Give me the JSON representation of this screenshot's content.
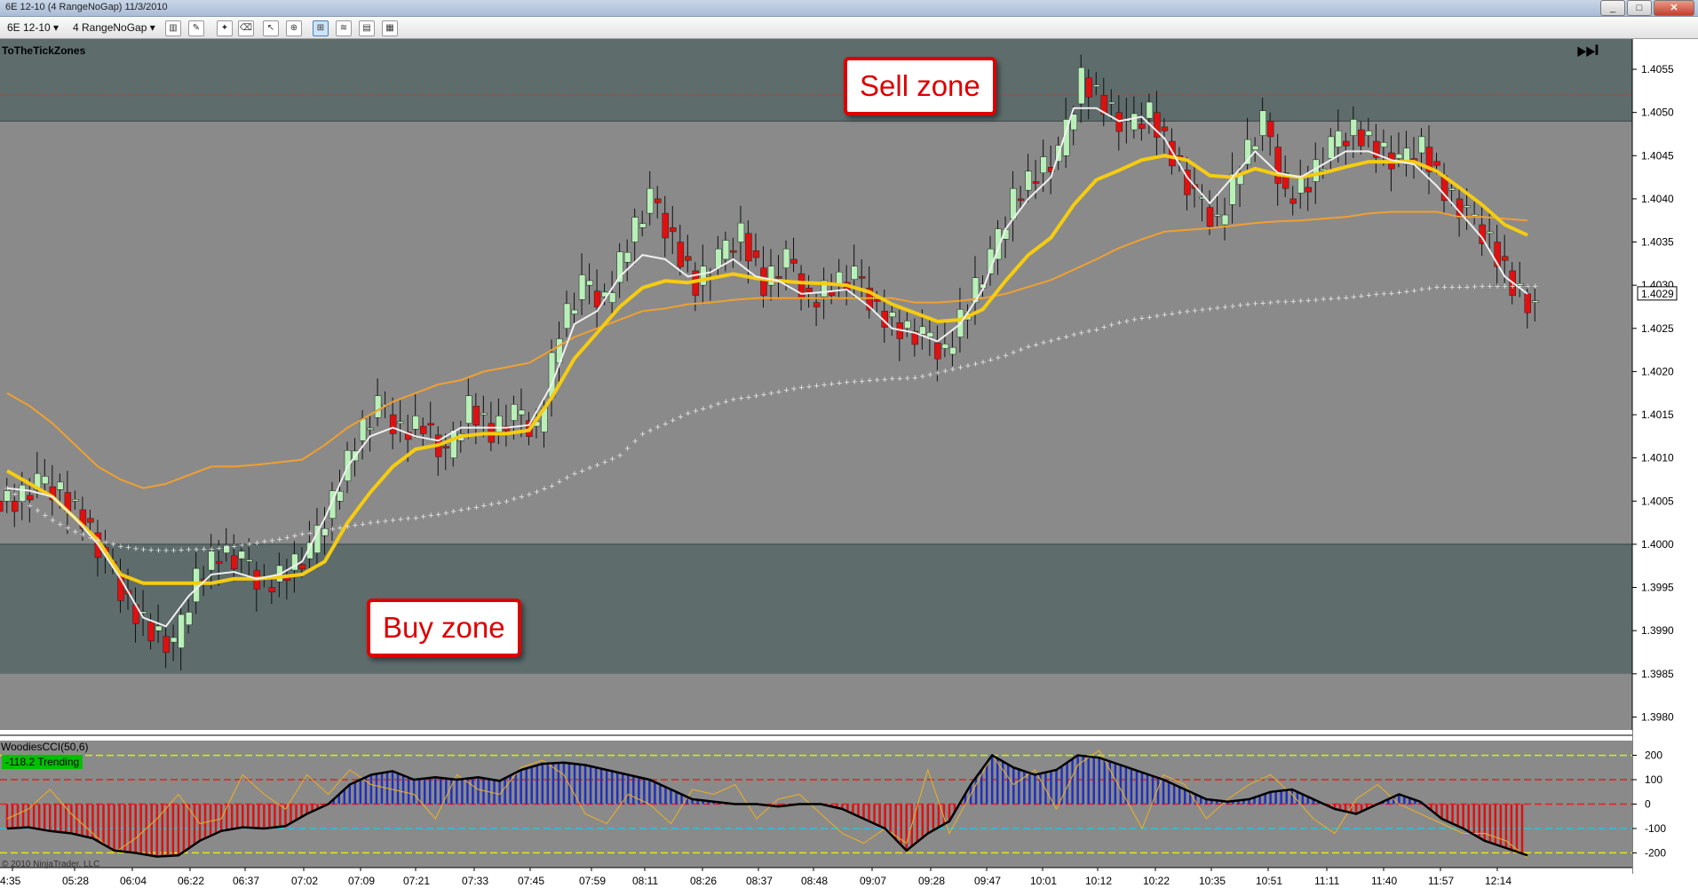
{
  "window": {
    "title": "6E 12-10 (4 RangeNoGap)  11/3/2010"
  },
  "toolbar": {
    "instrument": "6E 12-10",
    "period": "4 RangeNoGap"
  },
  "study": {
    "name": "ToTheTickZones"
  },
  "callouts": {
    "sell": "Sell zone",
    "buy": "Buy zone"
  },
  "cci": {
    "label": "WoodiesCCI(50,6)",
    "status": "-118.2 Trending",
    "status_color": "#00c000"
  },
  "footer": {
    "copyright": "© 2010 NinjaTrader, LLC"
  },
  "colors": {
    "bg_mid": "#8a8a8a",
    "bg_zone": "#5e6c6c",
    "up": "#b8f0b8",
    "down": "#e01010",
    "ema_fast": "#f0f0f0",
    "ema_mid": "#f5cc10",
    "ema_slow": "#f0a030",
    "dots": "#e8e8e8"
  },
  "chart_data": [
    {
      "type": "candlestick",
      "title": "ToTheTickZones",
      "y_ticks": [
        "1.4055",
        "1.4050",
        "1.4045",
        "1.4040",
        "1.4035",
        "1.4030",
        "1.4025",
        "1.4020",
        "1.4015",
        "1.4010",
        "1.4005",
        "1.4000",
        "1.3995",
        "1.3990",
        "1.3985",
        "1.3980"
      ],
      "ylim": [
        1.39785,
        1.40585
      ],
      "last_price": "1.4029",
      "x_ticks": [
        "4:35",
        "05:28",
        "06:04",
        "06:22",
        "06:37",
        "07:02",
        "07:09",
        "07:21",
        "07:33",
        "07:45",
        "07:59",
        "08:11",
        "08:26",
        "08:37",
        "08:48",
        "09:07",
        "09:28",
        "09:47",
        "10:01",
        "10:12",
        "10:22",
        "10:35",
        "10:51",
        "11:11",
        "11:40",
        "11:57",
        "12:14"
      ],
      "sell_zone": {
        "low": 1.4049,
        "high": 1.4058,
        "line": 1.4052
      },
      "buy_zone": {
        "low": 1.3985,
        "high": 1.4
      },
      "close_path": [
        1.4005,
        1.4007,
        1.4006,
        1.4003,
        1.3998,
        1.3993,
        1.399,
        1.3988,
        1.3996,
        1.3999,
        1.3998,
        1.3995,
        1.3997,
        1.3999,
        1.4005,
        1.4012,
        1.4016,
        1.4013,
        1.4014,
        1.401,
        1.4016,
        1.4013,
        1.4015,
        1.4013,
        1.4025,
        1.403,
        1.4028,
        1.4035,
        1.404,
        1.4035,
        1.403,
        1.4033,
        1.4036,
        1.403,
        1.4033,
        1.4028,
        1.403,
        1.4031,
        1.4027,
        1.4025,
        1.4024,
        1.4022,
        1.4028,
        1.4033,
        1.404,
        1.4043,
        1.4045,
        1.4054,
        1.4051,
        1.4048,
        1.405,
        1.4045,
        1.404,
        1.4037,
        1.4044,
        1.4049,
        1.404,
        1.4042,
        1.4046,
        1.4048,
        1.4046,
        1.4044,
        1.4046,
        1.4041,
        1.4038,
        1.4035,
        1.403,
        1.4027
      ],
      "ema_fast_path": [
        1.40065,
        1.40062,
        1.40055,
        1.4003,
        1.4,
        1.3996,
        1.39915,
        1.39905,
        1.3994,
        1.39965,
        1.39968,
        1.3996,
        1.39965,
        1.3998,
        1.4003,
        1.4009,
        1.40125,
        1.40135,
        1.40125,
        1.4012,
        1.40135,
        1.40135,
        1.40135,
        1.40138,
        1.40185,
        1.40255,
        1.4027,
        1.4031,
        1.40335,
        1.4033,
        1.4031,
        1.40315,
        1.4033,
        1.4031,
        1.40305,
        1.4029,
        1.40292,
        1.40295,
        1.40275,
        1.4025,
        1.40245,
        1.40235,
        1.40255,
        1.40295,
        1.40365,
        1.404,
        1.40425,
        1.40505,
        1.40505,
        1.4049,
        1.40495,
        1.4047,
        1.40425,
        1.40395,
        1.40425,
        1.40455,
        1.4043,
        1.40425,
        1.4044,
        1.40455,
        1.40455,
        1.40445,
        1.4044,
        1.40415,
        1.40385,
        1.40355,
        1.4031,
        1.4029
      ],
      "ema_mid_path": [
        1.40085,
        1.4007,
        1.40055,
        1.4003,
        1.40005,
        1.39965,
        1.39955,
        1.39955,
        1.39955,
        1.39955,
        1.3996,
        1.3996,
        1.39962,
        1.39965,
        1.3998,
        1.40025,
        1.4006,
        1.4009,
        1.4011,
        1.40115,
        1.40125,
        1.40128,
        1.40128,
        1.40132,
        1.4017,
        1.40215,
        1.40245,
        1.40275,
        1.40297,
        1.40305,
        1.40303,
        1.40308,
        1.40313,
        1.40308,
        1.40305,
        1.40303,
        1.40302,
        1.403,
        1.40292,
        1.40278,
        1.40268,
        1.40258,
        1.4026,
        1.40272,
        1.40305,
        1.40335,
        1.40355,
        1.40393,
        1.40422,
        1.40433,
        1.40445,
        1.4045,
        1.40445,
        1.40427,
        1.40425,
        1.40435,
        1.40428,
        1.40425,
        1.4043,
        1.40437,
        1.40443,
        1.40443,
        1.40443,
        1.40432,
        1.40413,
        1.40393,
        1.4037,
        1.40358
      ],
      "ema_slow_path": [
        1.40175,
        1.4016,
        1.4014,
        1.40115,
        1.4009,
        1.40075,
        1.40065,
        1.4007,
        1.4008,
        1.4009,
        1.4009,
        1.40092,
        1.40095,
        1.40098,
        1.40115,
        1.40135,
        1.4015,
        1.40165,
        1.40175,
        1.40185,
        1.4019,
        1.402,
        1.40205,
        1.4021,
        1.40225,
        1.4024,
        1.4025,
        1.4026,
        1.4027,
        1.40273,
        1.40278,
        1.4028,
        1.40283,
        1.40285,
        1.40285,
        1.40285,
        1.40285,
        1.40285,
        1.40285,
        1.40285,
        1.4028,
        1.4028,
        1.40282,
        1.40285,
        1.4029,
        1.40298,
        1.40306,
        1.40318,
        1.4033,
        1.40343,
        1.40353,
        1.40362,
        1.40364,
        1.40366,
        1.40369,
        1.40372,
        1.40374,
        1.40375,
        1.40377,
        1.40379,
        1.40383,
        1.40385,
        1.40385,
        1.40385,
        1.40379,
        1.40379,
        1.40377,
        1.40375
      ],
      "dots_path": [
        1.40065,
        1.40045,
        1.40028,
        1.40015,
        1.40005,
        1.39998,
        1.39994,
        1.39993,
        1.39994,
        1.39995,
        1.39998,
        1.40002,
        1.40006,
        1.40012,
        1.40016,
        1.40021,
        1.40025,
        1.40028,
        1.40031,
        1.40035,
        1.4004,
        1.40045,
        1.4005,
        1.40058,
        1.40068,
        1.40082,
        1.40092,
        1.40103,
        1.40128,
        1.4014,
        1.40152,
        1.4016,
        1.40168,
        1.40172,
        1.40177,
        1.40182,
        1.40185,
        1.40188,
        1.4019,
        1.40192,
        1.40193,
        1.40199,
        1.40205,
        1.40211,
        1.40219,
        1.40229,
        1.40236,
        1.40243,
        1.40249,
        1.40257,
        1.40262,
        1.40266,
        1.4027,
        1.40273,
        1.40276,
        1.40279,
        1.40281,
        1.40282,
        1.40284,
        1.40286,
        1.40289,
        1.40291,
        1.40294,
        1.40298,
        1.40298,
        1.40299,
        1.40299,
        1.40299
      ]
    },
    {
      "type": "histogram-line",
      "title": "WoodiesCCI(50,6)",
      "y_ticks": [
        "200",
        "100",
        "0",
        "-100",
        "-200"
      ],
      "ylim": [
        -260,
        260
      ],
      "levels": [
        200,
        100,
        0,
        -100,
        -200
      ],
      "cci_path": [
        -100,
        -95,
        -110,
        -120,
        -140,
        -190,
        -200,
        -215,
        -210,
        -150,
        -110,
        -95,
        -100,
        -90,
        -40,
        0,
        80,
        120,
        135,
        100,
        110,
        100,
        110,
        95,
        140,
        165,
        170,
        160,
        140,
        120,
        100,
        60,
        20,
        10,
        0,
        0,
        -10,
        0,
        0,
        -20,
        -60,
        -100,
        -190,
        -120,
        -70,
        80,
        200,
        150,
        120,
        140,
        200,
        190,
        160,
        130,
        100,
        60,
        20,
        10,
        20,
        50,
        60,
        20,
        -20,
        -40,
        0,
        40,
        10,
        -60,
        -100,
        -150,
        -180,
        -210
      ],
      "turbo_path": [
        -60,
        -20,
        60,
        -40,
        -120,
        -200,
        -140,
        -60,
        40,
        -80,
        -60,
        120,
        40,
        -20,
        120,
        40,
        140,
        80,
        60,
        40,
        -60,
        120,
        60,
        40,
        150,
        180,
        120,
        -40,
        -80,
        40,
        0,
        -80,
        60,
        40,
        80,
        -60,
        20,
        40,
        -40,
        -120,
        -160,
        -100,
        -160,
        140,
        -120,
        40,
        200,
        80,
        140,
        -20,
        160,
        220,
        60,
        -100,
        120,
        80,
        -60,
        20,
        80,
        120,
        40,
        -60,
        -120,
        20,
        80,
        0,
        -40,
        -80,
        -120,
        -120,
        -150,
        -220
      ]
    }
  ]
}
